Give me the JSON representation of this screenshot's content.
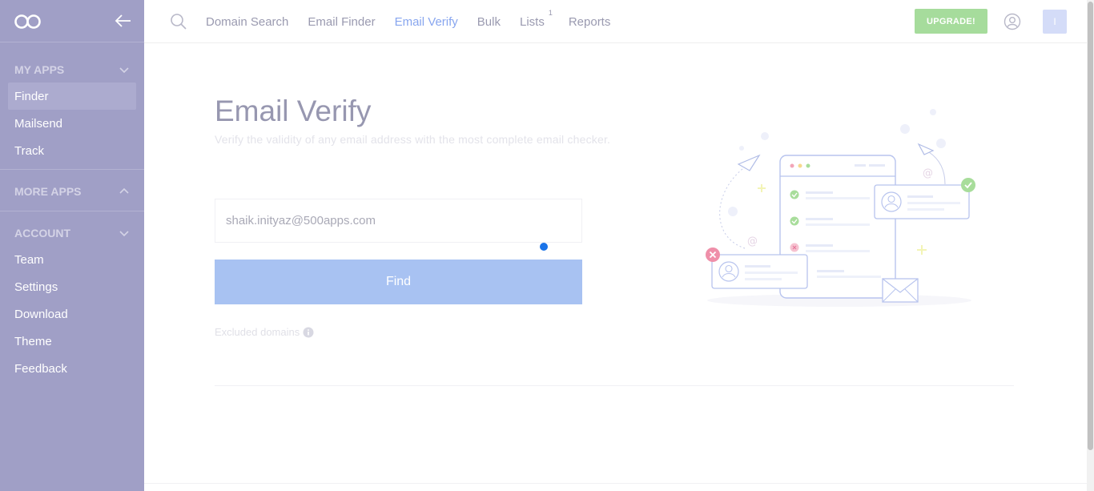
{
  "sidebar": {
    "sections": {
      "my_apps": {
        "label": "MY APPS"
      },
      "more_apps": {
        "label": "MORE APPS"
      },
      "account": {
        "label": "ACCOUNT"
      }
    },
    "my_apps_items": [
      "Finder",
      "Mailsend",
      "Track"
    ],
    "account_items": [
      "Team",
      "Settings",
      "Download",
      "Theme",
      "Feedback"
    ],
    "active_item": "Finder"
  },
  "topbar": {
    "nav": [
      {
        "label": "Domain Search"
      },
      {
        "label": "Email Finder"
      },
      {
        "label": "Email Verify",
        "active": true
      },
      {
        "label": "Bulk"
      },
      {
        "label": "Lists",
        "badge": "1"
      },
      {
        "label": "Reports"
      }
    ],
    "upgrade_label": "UPGRADE!",
    "avatar_initial": "I"
  },
  "main": {
    "title": "Email Verify",
    "subtitle": "Verify the validity of any email address with the most complete email checker.",
    "email_value": "shaik.inityaz@500apps.com",
    "find_label": "Find",
    "excluded_label": "Excluded domains"
  },
  "colors": {
    "sidebar_bg": "#a09fc6",
    "accent": "#88a6ef",
    "find_button": "#a8c2f2",
    "upgrade_button": "#a6dc9c"
  },
  "icons": {
    "logo": "infinity-logo-icon",
    "collapse": "arrow-left-icon",
    "search": "search-icon",
    "user": "user-circle-icon",
    "info": "info-icon",
    "chevron": "chevron-icon"
  }
}
